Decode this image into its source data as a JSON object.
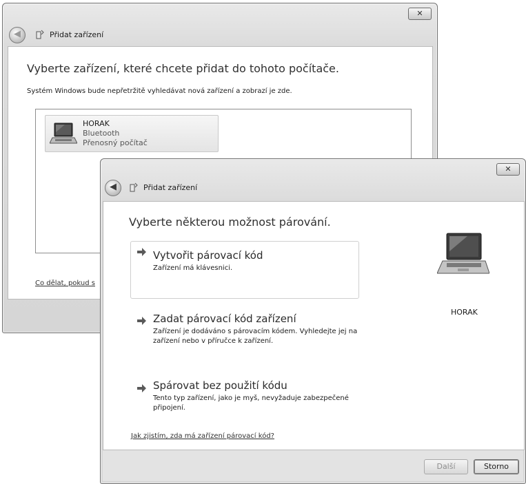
{
  "back_window": {
    "title": "Přidat zařízení",
    "close_label": "✕",
    "heading": "Vyberte zařízení, které chcete přidat do tohoto počítače.",
    "description": "Systém Windows bude nepřetržitě vyhledávat nová zařízení a zobrazí je zde.",
    "device": {
      "name": "HORAK",
      "type": "Bluetooth",
      "category": "Přenosný počítač",
      "icon": "laptop-icon"
    },
    "help_link": "Co dělat, pokud s"
  },
  "front_window": {
    "title": "Přidat zařízení",
    "close_label": "✕",
    "heading": "Vyberte některou možnost párování.",
    "options": [
      {
        "title": "Vytvořit párovací kód",
        "desc": "Zařízení má klávesnici."
      },
      {
        "title": "Zadat párovací kód zařízení",
        "desc": "Zařízení je dodáváno s párovacím kódem. Vyhledejte jej na zařízení nebo v příručce k zařízení."
      },
      {
        "title": "Spárovat bez použití kódu",
        "desc": "Tento typ zařízení, jako je myš, nevyžaduje zabezpečené připojení."
      }
    ],
    "device_label": "HORAK",
    "help_link": "Jak zjistím, zda má zařízení párovací kód?",
    "buttons": {
      "next": "Další",
      "cancel": "Storno"
    }
  },
  "colors": {
    "chrome": "#dcdcdc",
    "content": "#ffffff",
    "border": "#6f6f6f"
  }
}
